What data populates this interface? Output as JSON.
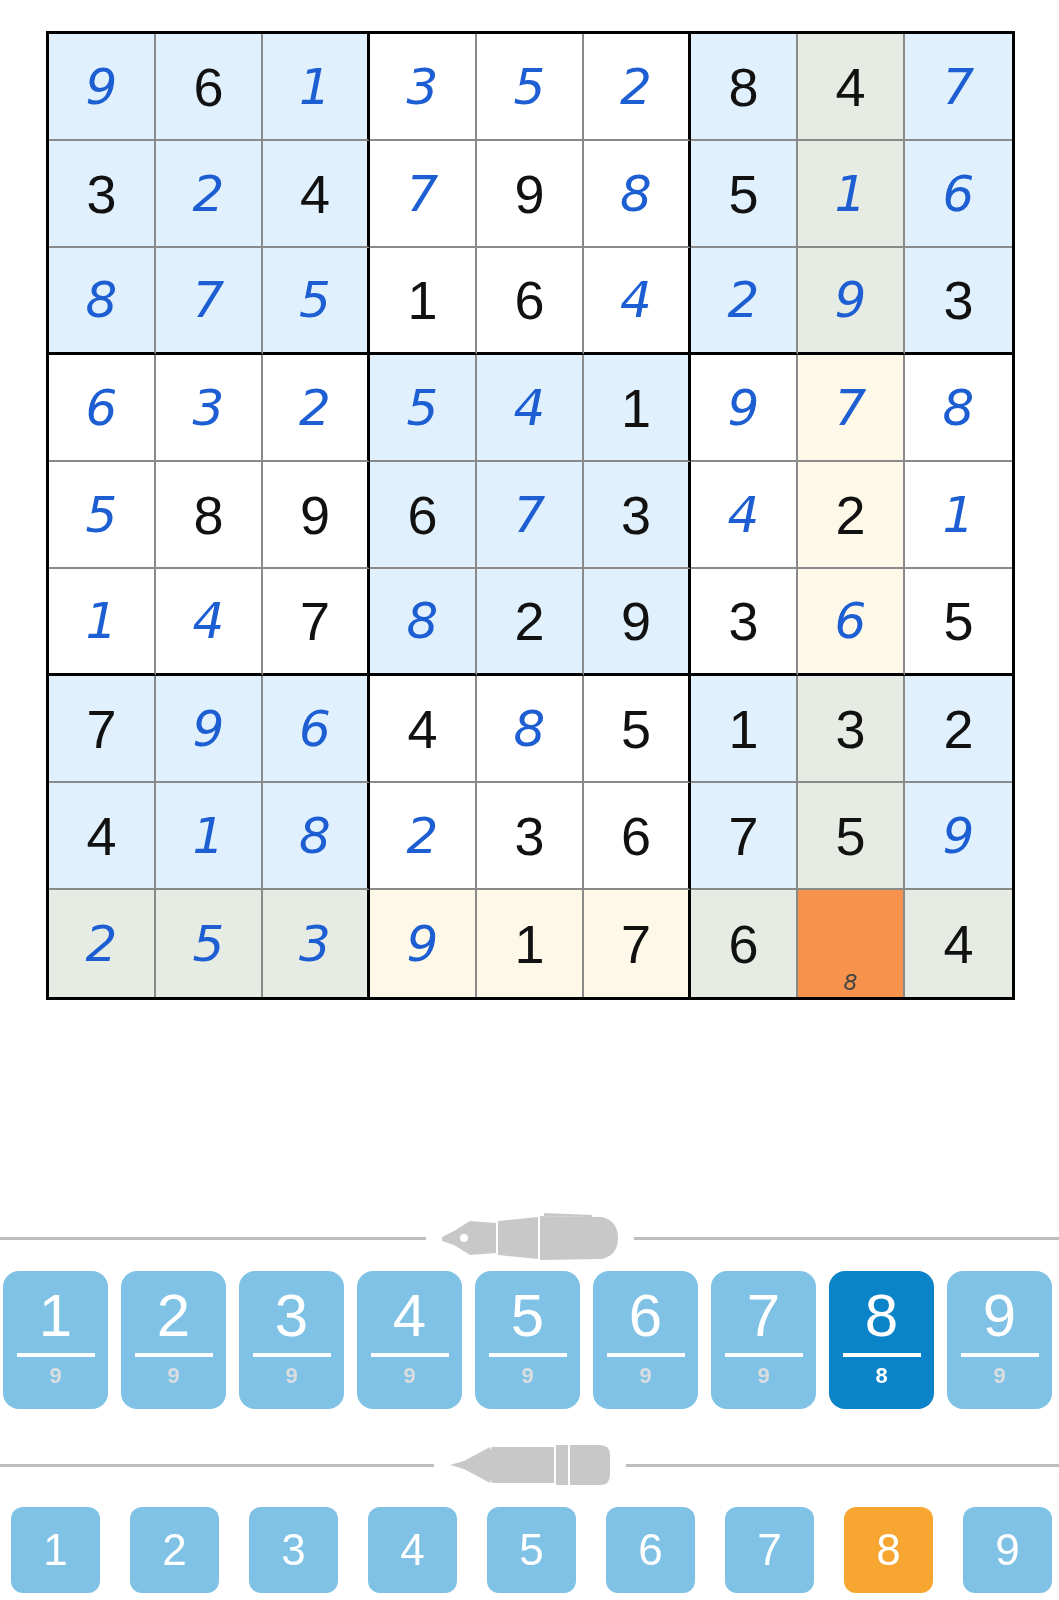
{
  "board": {
    "rows": [
      {
        "cells": [
          {
            "value": "9",
            "kind": "entered",
            "highlighted": false,
            "selected": false
          },
          {
            "value": "6",
            "kind": "given",
            "highlighted": false,
            "selected": false
          },
          {
            "value": "1",
            "kind": "entered",
            "highlighted": false,
            "selected": false
          },
          {
            "value": "3",
            "kind": "entered",
            "highlighted": false,
            "selected": false
          },
          {
            "value": "5",
            "kind": "entered",
            "highlighted": false,
            "selected": false
          },
          {
            "value": "2",
            "kind": "entered",
            "highlighted": false,
            "selected": false
          },
          {
            "value": "8",
            "kind": "given",
            "highlighted": false,
            "selected": false
          },
          {
            "value": "4",
            "kind": "given",
            "highlighted": true,
            "selected": false
          },
          {
            "value": "7",
            "kind": "entered",
            "highlighted": false,
            "selected": false
          }
        ]
      },
      {
        "cells": [
          {
            "value": "3",
            "kind": "given",
            "highlighted": false,
            "selected": false
          },
          {
            "value": "2",
            "kind": "entered",
            "highlighted": false,
            "selected": false
          },
          {
            "value": "4",
            "kind": "given",
            "highlighted": false,
            "selected": false
          },
          {
            "value": "7",
            "kind": "entered",
            "highlighted": false,
            "selected": false
          },
          {
            "value": "9",
            "kind": "given",
            "highlighted": false,
            "selected": false
          },
          {
            "value": "8",
            "kind": "entered",
            "highlighted": false,
            "selected": false
          },
          {
            "value": "5",
            "kind": "given",
            "highlighted": false,
            "selected": false
          },
          {
            "value": "1",
            "kind": "entered",
            "highlighted": true,
            "selected": false
          },
          {
            "value": "6",
            "kind": "entered",
            "highlighted": false,
            "selected": false
          }
        ]
      },
      {
        "cells": [
          {
            "value": "8",
            "kind": "entered",
            "highlighted": false,
            "selected": false
          },
          {
            "value": "7",
            "kind": "entered",
            "highlighted": false,
            "selected": false
          },
          {
            "value": "5",
            "kind": "entered",
            "highlighted": false,
            "selected": false
          },
          {
            "value": "1",
            "kind": "given",
            "highlighted": false,
            "selected": false
          },
          {
            "value": "6",
            "kind": "given",
            "highlighted": false,
            "selected": false
          },
          {
            "value": "4",
            "kind": "entered",
            "highlighted": false,
            "selected": false
          },
          {
            "value": "2",
            "kind": "entered",
            "highlighted": false,
            "selected": false
          },
          {
            "value": "9",
            "kind": "entered",
            "highlighted": true,
            "selected": false
          },
          {
            "value": "3",
            "kind": "given",
            "highlighted": false,
            "selected": false
          }
        ]
      },
      {
        "cells": [
          {
            "value": "6",
            "kind": "entered",
            "highlighted": false,
            "selected": false
          },
          {
            "value": "3",
            "kind": "entered",
            "highlighted": false,
            "selected": false
          },
          {
            "value": "2",
            "kind": "entered",
            "highlighted": false,
            "selected": false
          },
          {
            "value": "5",
            "kind": "entered",
            "highlighted": false,
            "selected": false
          },
          {
            "value": "4",
            "kind": "entered",
            "highlighted": false,
            "selected": false
          },
          {
            "value": "1",
            "kind": "given",
            "highlighted": false,
            "selected": false
          },
          {
            "value": "9",
            "kind": "entered",
            "highlighted": false,
            "selected": false
          },
          {
            "value": "7",
            "kind": "entered",
            "highlighted": true,
            "selected": false
          },
          {
            "value": "8",
            "kind": "entered",
            "highlighted": false,
            "selected": false
          }
        ]
      },
      {
        "cells": [
          {
            "value": "5",
            "kind": "entered",
            "highlighted": false,
            "selected": false
          },
          {
            "value": "8",
            "kind": "given",
            "highlighted": false,
            "selected": false
          },
          {
            "value": "9",
            "kind": "given",
            "highlighted": false,
            "selected": false
          },
          {
            "value": "6",
            "kind": "given",
            "highlighted": false,
            "selected": false
          },
          {
            "value": "7",
            "kind": "entered",
            "highlighted": false,
            "selected": false
          },
          {
            "value": "3",
            "kind": "given",
            "highlighted": false,
            "selected": false
          },
          {
            "value": "4",
            "kind": "entered",
            "highlighted": false,
            "selected": false
          },
          {
            "value": "2",
            "kind": "given",
            "highlighted": true,
            "selected": false
          },
          {
            "value": "1",
            "kind": "entered",
            "highlighted": false,
            "selected": false
          }
        ]
      },
      {
        "cells": [
          {
            "value": "1",
            "kind": "entered",
            "highlighted": false,
            "selected": false
          },
          {
            "value": "4",
            "kind": "entered",
            "highlighted": false,
            "selected": false
          },
          {
            "value": "7",
            "kind": "given",
            "highlighted": false,
            "selected": false
          },
          {
            "value": "8",
            "kind": "entered",
            "highlighted": false,
            "selected": false
          },
          {
            "value": "2",
            "kind": "given",
            "highlighted": false,
            "selected": false
          },
          {
            "value": "9",
            "kind": "given",
            "highlighted": false,
            "selected": false
          },
          {
            "value": "3",
            "kind": "given",
            "highlighted": false,
            "selected": false
          },
          {
            "value": "6",
            "kind": "entered",
            "highlighted": true,
            "selected": false
          },
          {
            "value": "5",
            "kind": "given",
            "highlighted": false,
            "selected": false
          }
        ]
      },
      {
        "cells": [
          {
            "value": "7",
            "kind": "given",
            "highlighted": false,
            "selected": false
          },
          {
            "value": "9",
            "kind": "entered",
            "highlighted": false,
            "selected": false
          },
          {
            "value": "6",
            "kind": "entered",
            "highlighted": false,
            "selected": false
          },
          {
            "value": "4",
            "kind": "given",
            "highlighted": false,
            "selected": false
          },
          {
            "value": "8",
            "kind": "entered",
            "highlighted": false,
            "selected": false
          },
          {
            "value": "5",
            "kind": "given",
            "highlighted": false,
            "selected": false
          },
          {
            "value": "1",
            "kind": "given",
            "highlighted": false,
            "selected": false
          },
          {
            "value": "3",
            "kind": "given",
            "highlighted": true,
            "selected": false
          },
          {
            "value": "2",
            "kind": "given",
            "highlighted": false,
            "selected": false
          }
        ]
      },
      {
        "cells": [
          {
            "value": "4",
            "kind": "given",
            "highlighted": false,
            "selected": false
          },
          {
            "value": "1",
            "kind": "entered",
            "highlighted": false,
            "selected": false
          },
          {
            "value": "8",
            "kind": "entered",
            "highlighted": false,
            "selected": false
          },
          {
            "value": "2",
            "kind": "entered",
            "highlighted": false,
            "selected": false
          },
          {
            "value": "3",
            "kind": "given",
            "highlighted": false,
            "selected": false
          },
          {
            "value": "6",
            "kind": "given",
            "highlighted": false,
            "selected": false
          },
          {
            "value": "7",
            "kind": "given",
            "highlighted": false,
            "selected": false
          },
          {
            "value": "5",
            "kind": "given",
            "highlighted": true,
            "selected": false
          },
          {
            "value": "9",
            "kind": "entered",
            "highlighted": false,
            "selected": false
          }
        ]
      },
      {
        "cells": [
          {
            "value": "2",
            "kind": "entered",
            "highlighted": true,
            "selected": false
          },
          {
            "value": "5",
            "kind": "entered",
            "highlighted": true,
            "selected": false
          },
          {
            "value": "3",
            "kind": "entered",
            "highlighted": true,
            "selected": false
          },
          {
            "value": "9",
            "kind": "entered",
            "highlighted": true,
            "selected": false
          },
          {
            "value": "1",
            "kind": "given",
            "highlighted": true,
            "selected": false
          },
          {
            "value": "7",
            "kind": "given",
            "highlighted": true,
            "selected": false
          },
          {
            "value": "6",
            "kind": "given",
            "highlighted": true,
            "selected": false
          },
          {
            "kind": "empty",
            "notes": [
              "8"
            ],
            "highlighted": true,
            "selected": true
          },
          {
            "value": "4",
            "kind": "given",
            "highlighted": true,
            "selected": false
          }
        ]
      }
    ]
  },
  "pen_pad": {
    "buttons": [
      {
        "digit": "1",
        "count": "9",
        "selected": false
      },
      {
        "digit": "2",
        "count": "9",
        "selected": false
      },
      {
        "digit": "3",
        "count": "9",
        "selected": false
      },
      {
        "digit": "4",
        "count": "9",
        "selected": false
      },
      {
        "digit": "5",
        "count": "9",
        "selected": false
      },
      {
        "digit": "6",
        "count": "9",
        "selected": false
      },
      {
        "digit": "7",
        "count": "9",
        "selected": false
      },
      {
        "digit": "8",
        "count": "8",
        "selected": true
      },
      {
        "digit": "9",
        "count": "9",
        "selected": false
      }
    ]
  },
  "pencil_pad": {
    "buttons": [
      {
        "digit": "1",
        "selected": false
      },
      {
        "digit": "2",
        "selected": false
      },
      {
        "digit": "3",
        "selected": false
      },
      {
        "digit": "4",
        "selected": false
      },
      {
        "digit": "5",
        "selected": false
      },
      {
        "digit": "6",
        "selected": false
      },
      {
        "digit": "7",
        "selected": false
      },
      {
        "digit": "8",
        "selected": true
      },
      {
        "digit": "9",
        "selected": false
      }
    ]
  }
}
